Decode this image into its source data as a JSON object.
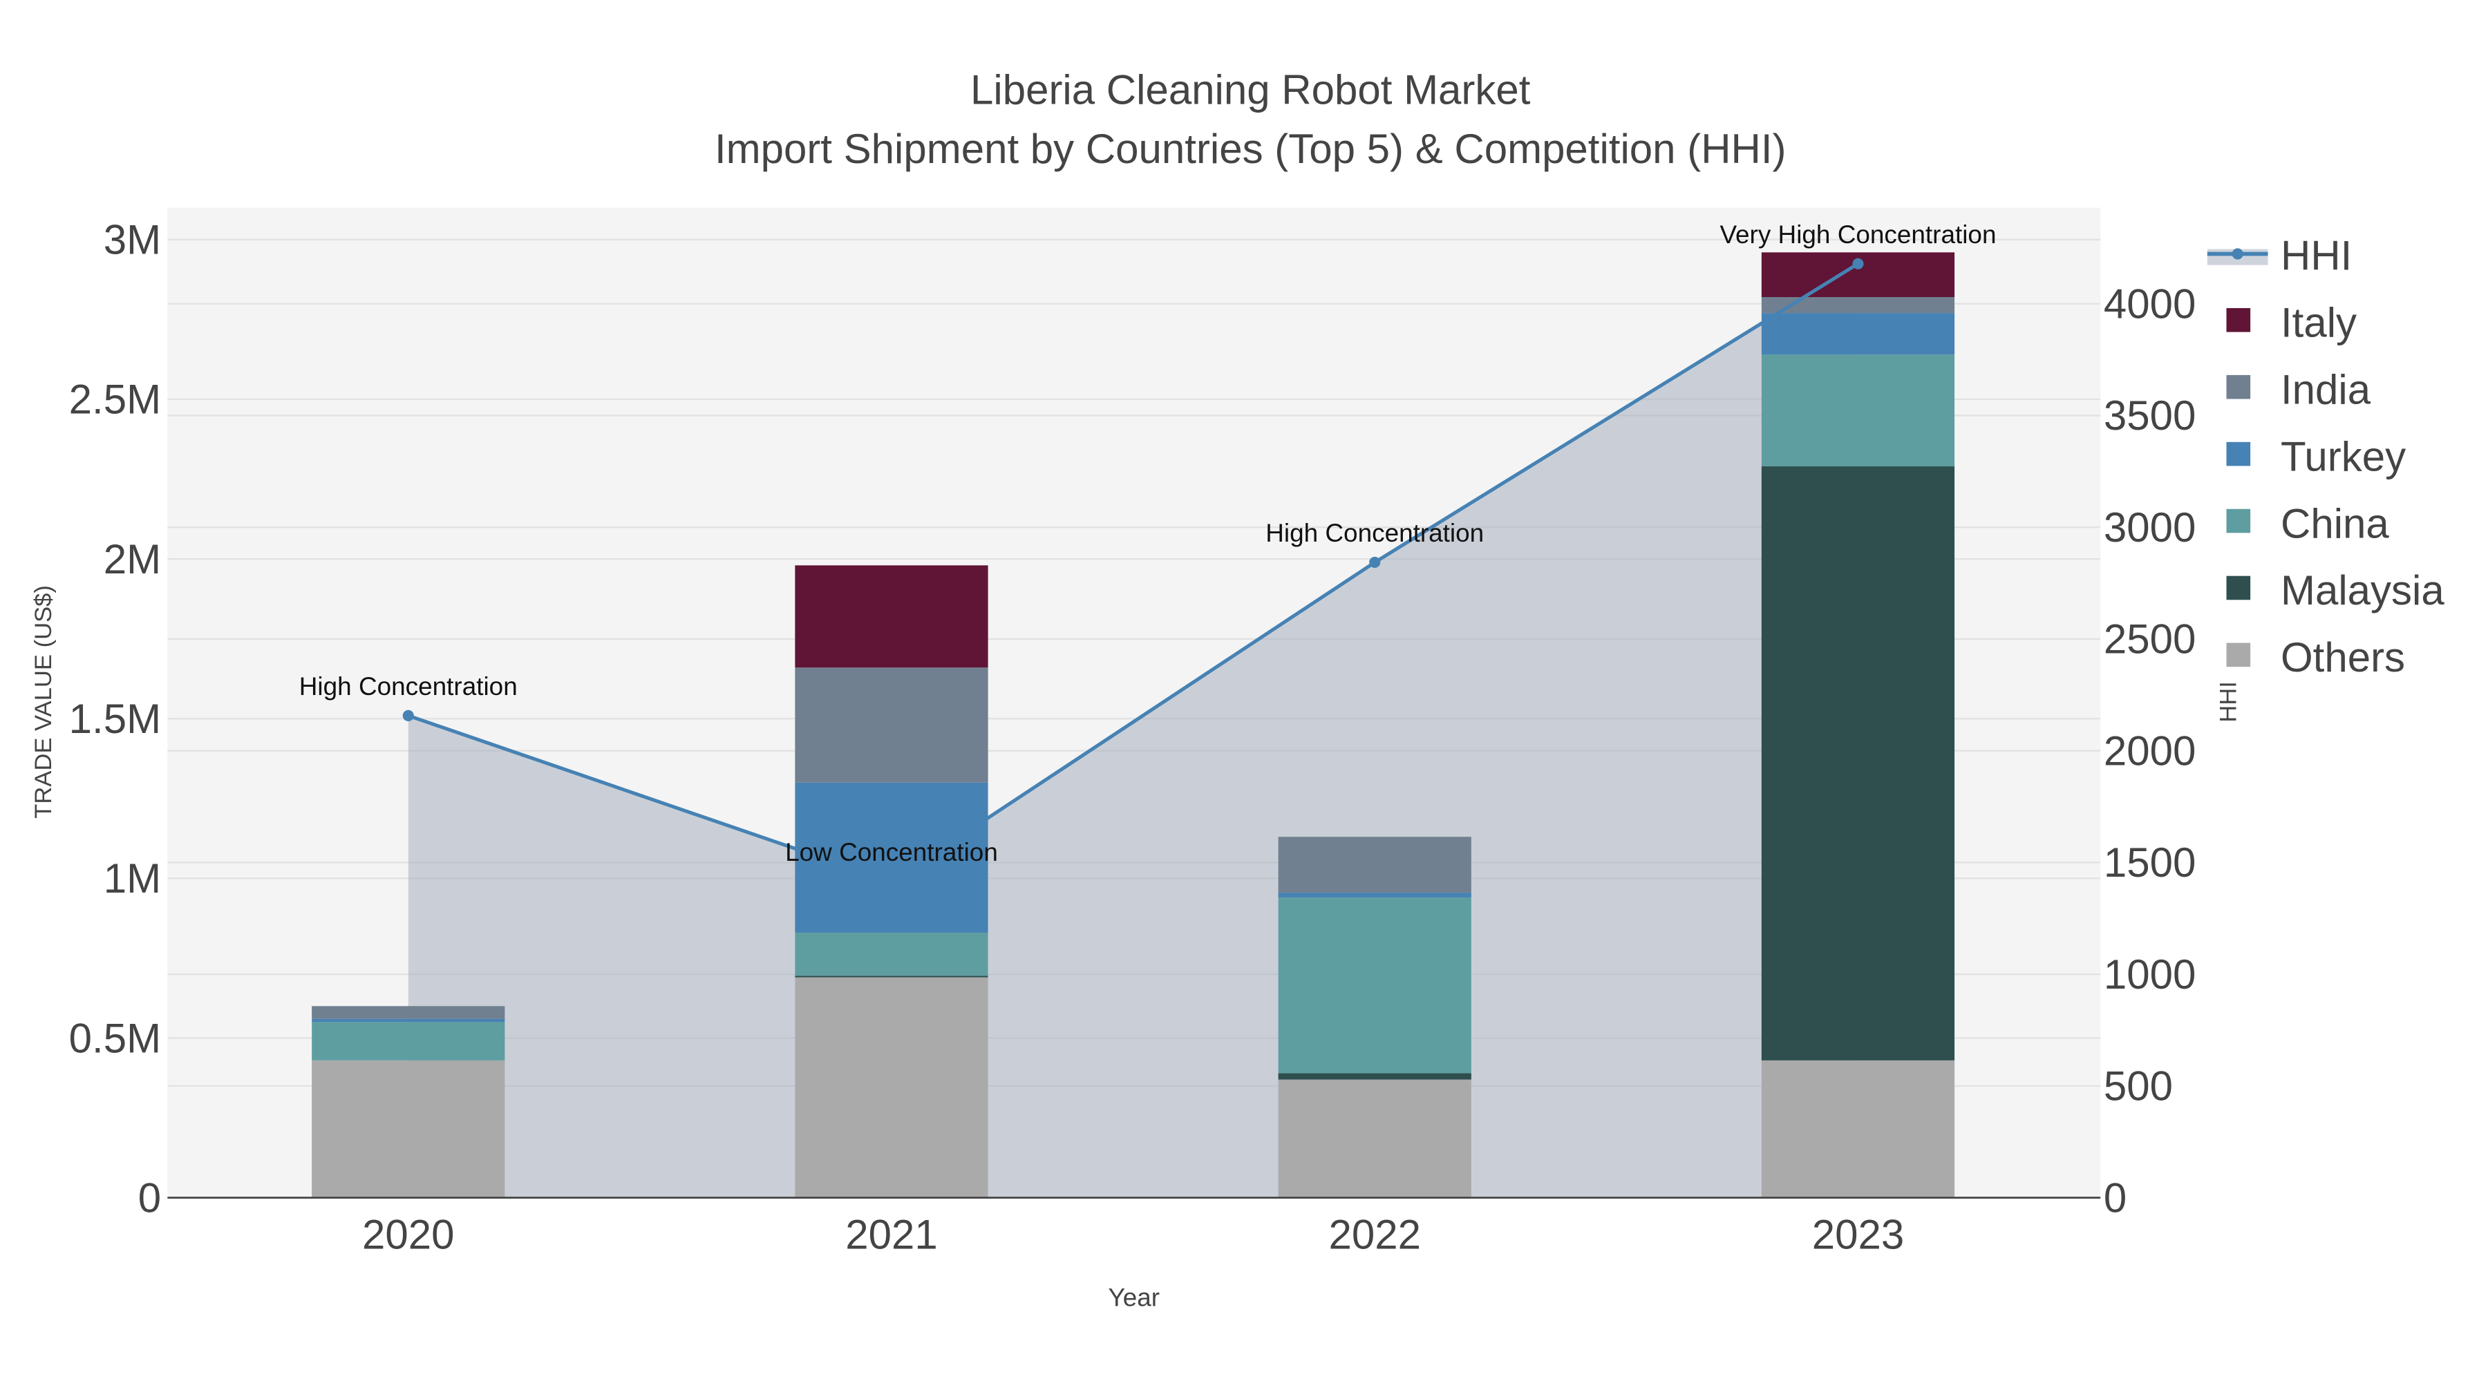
{
  "chart_data": {
    "type": "bar",
    "title": "Liberia Cleaning Robot Market",
    "subtitle": "Import Shipment by Countries (Top 5) & Competition (HHI)",
    "xlabel": "Year",
    "ylabel": "TRADE VALUE (US$)",
    "y2label": "HHI",
    "categories": [
      "2020",
      "2021",
      "2022",
      "2023"
    ],
    "ylim": [
      0,
      3100000
    ],
    "y2lim": [
      0,
      4430
    ],
    "yticks": [
      {
        "v": 0,
        "label": "0"
      },
      {
        "v": 500000,
        "label": "0.5M"
      },
      {
        "v": 1000000,
        "label": "1M"
      },
      {
        "v": 1500000,
        "label": "1.5M"
      },
      {
        "v": 2000000,
        "label": "2M"
      },
      {
        "v": 2500000,
        "label": "2.5M"
      },
      {
        "v": 3000000,
        "label": "3M"
      }
    ],
    "y2ticks": [
      {
        "v": 0,
        "label": "0"
      },
      {
        "v": 500,
        "label": "500"
      },
      {
        "v": 1000,
        "label": "1000"
      },
      {
        "v": 1500,
        "label": "1500"
      },
      {
        "v": 2000,
        "label": "2000"
      },
      {
        "v": 2500,
        "label": "2500"
      },
      {
        "v": 3000,
        "label": "3000"
      },
      {
        "v": 3500,
        "label": "3500"
      },
      {
        "v": 4000,
        "label": "4000"
      }
    ],
    "series": [
      {
        "name": "Others",
        "color": "#aaaaaa",
        "values": [
          430000,
          690000,
          370000,
          430000
        ]
      },
      {
        "name": "Malaysia",
        "color": "#2f4f4f",
        "values": [
          0,
          5000,
          20000,
          1860000
        ]
      },
      {
        "name": "China",
        "color": "#5f9ea0",
        "values": [
          120000,
          135000,
          550000,
          350000
        ]
      },
      {
        "name": "Turkey",
        "color": "#4682b4",
        "values": [
          10000,
          470000,
          15000,
          130000
        ]
      },
      {
        "name": "India",
        "color": "#708090",
        "values": [
          40000,
          360000,
          175000,
          50000
        ]
      },
      {
        "name": "Italy",
        "color": "#601436",
        "values": [
          0,
          320000,
          0,
          140000
        ]
      }
    ],
    "hhi": {
      "name": "HHI",
      "color": "#4682b4",
      "values": [
        2157,
        1414,
        2843,
        4179
      ],
      "annotations": [
        "High Concentration",
        "Low Concentration",
        "High Concentration",
        "Very High Concentration"
      ]
    },
    "legend_order": [
      "HHI",
      "Italy",
      "India",
      "Turkey",
      "China",
      "Malaysia",
      "Others"
    ],
    "legend": "right",
    "grid": true
  }
}
